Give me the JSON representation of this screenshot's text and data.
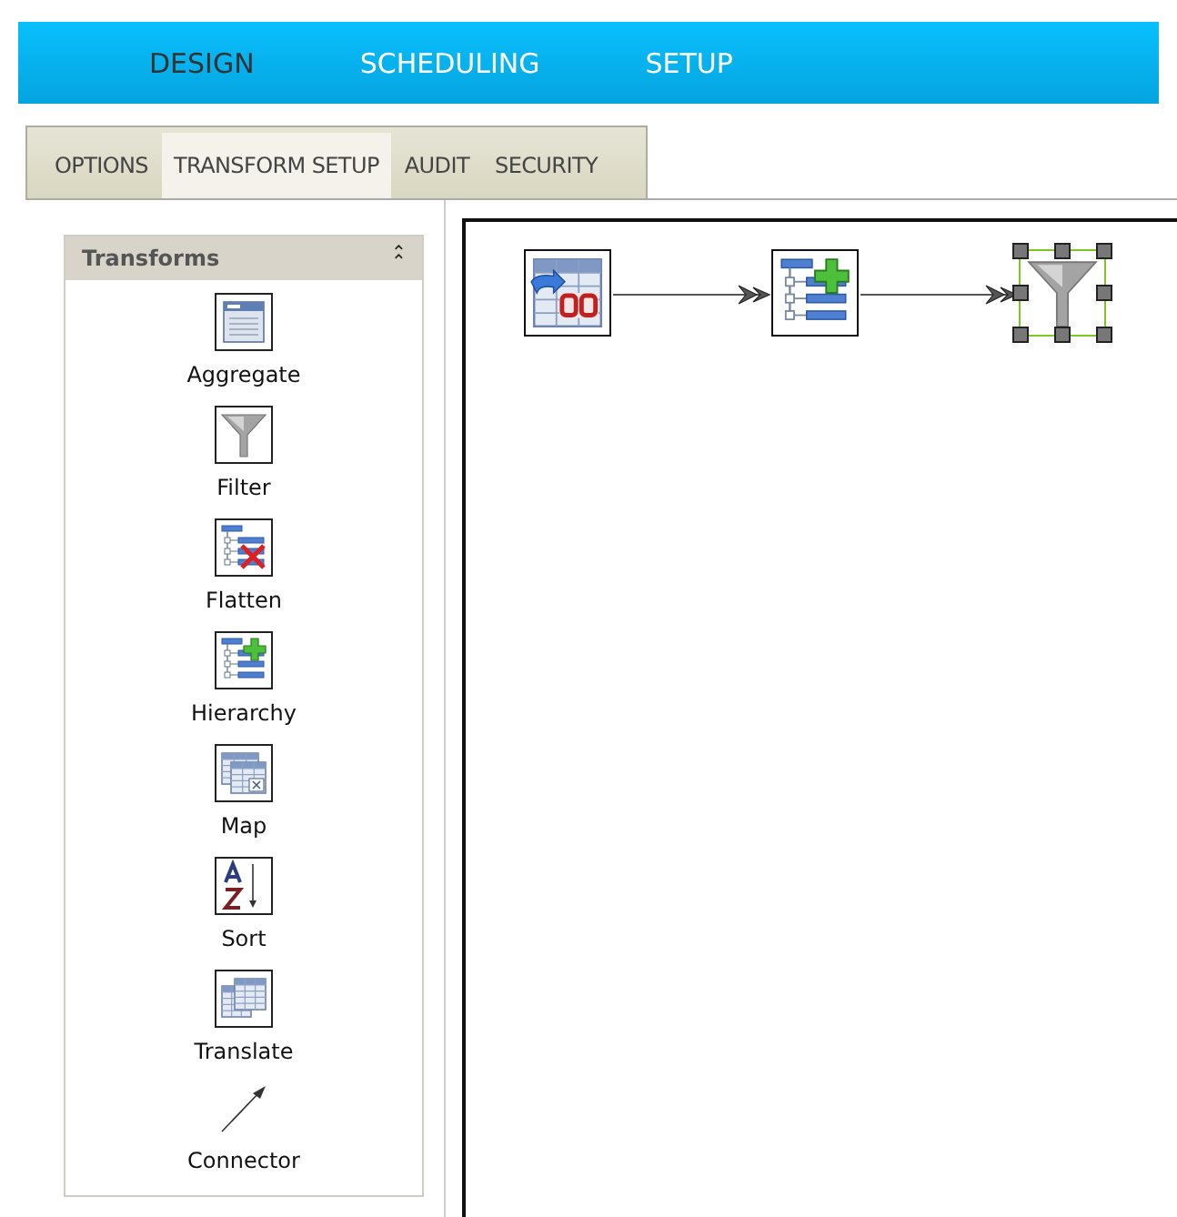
{
  "main_tabs": [
    {
      "label": "DESIGN",
      "selected": true
    },
    {
      "label": "SCHEDULING",
      "selected": false
    },
    {
      "label": "SETUP",
      "selected": false
    }
  ],
  "sub_tabs": [
    {
      "label": "OPTIONS",
      "selected": false
    },
    {
      "label": "TRANSFORM SETUP",
      "selected": true
    },
    {
      "label": "AUDIT",
      "selected": false
    },
    {
      "label": "SECURITY",
      "selected": false
    }
  ],
  "palette": {
    "title": "Transforms",
    "collapse_glyph": "⌃",
    "expanded": true,
    "items": [
      {
        "kind": "aggregate",
        "label": "Aggregate"
      },
      {
        "kind": "filter",
        "label": "Filter"
      },
      {
        "kind": "flatten",
        "label": "Flatten"
      },
      {
        "kind": "hierarchy",
        "label": "Hierarchy"
      },
      {
        "kind": "map",
        "label": "Map"
      },
      {
        "kind": "sort",
        "label": "Sort"
      },
      {
        "kind": "translate",
        "label": "Translate"
      },
      {
        "kind": "connector",
        "label": "Connector"
      }
    ]
  },
  "canvas": {
    "nodes": [
      {
        "kind": "database",
        "selected": false
      },
      {
        "kind": "hierarchy",
        "selected": false
      },
      {
        "kind": "filter",
        "selected": true
      }
    ]
  }
}
